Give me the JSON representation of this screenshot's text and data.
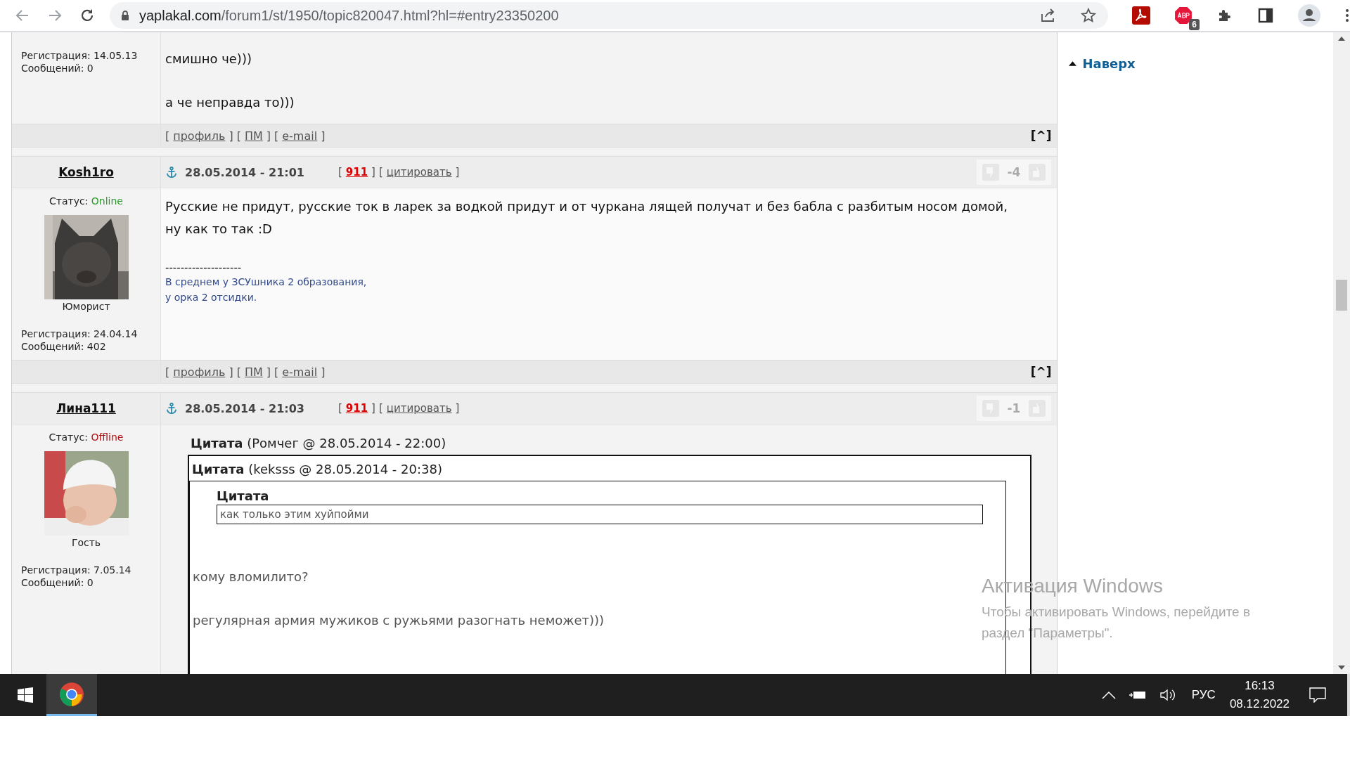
{
  "browser": {
    "url_host": "yaplakal.com",
    "url_path": "/forum1/st/1950/topic820047.html?hl=#entry23350200",
    "extension_badge": "6"
  },
  "posts": [
    {
      "registration": "Регистрация: 14.05.13",
      "messages": "Сообщений: 0",
      "body": [
        {
          "kind": "text",
          "text": "смишно че)))"
        },
        {
          "kind": "text",
          "text": "а че неправда то)))"
        }
      ],
      "footer": [
        {
          "open": "[",
          "text": "профиль",
          "close": "]"
        },
        {
          "open": "[",
          "text": "ПМ",
          "close": "]"
        },
        {
          "open": "[",
          "text": "e-mail",
          "close": "]"
        }
      ],
      "top_link": "[^]"
    },
    {
      "header": {
        "author": "Kosh1ro",
        "date": "28.05.2014 - 21:01",
        "report": {
          "open": "[",
          "text": "911",
          "close": "]"
        },
        "quote": {
          "open": "[",
          "text": "цитировать",
          "close": "]"
        },
        "rating": "-4"
      },
      "status_label": "Статус:",
      "status": "Online",
      "online": true,
      "avatar": {
        "kind": "picture"
      },
      "rank": "Юморист",
      "registration": "Регистрация: 24.04.14",
      "messages": "Сообщений: 402",
      "body": [
        {
          "kind": "text",
          "text": "Русские не придут, русские ток в ларек за водкой придут и от чуркана лящей получат и без бабла с разбитым носом домой, ну как то так :D"
        },
        {
          "kind": "rule",
          "text": "--------------------"
        },
        {
          "kind": "signature",
          "lines": [
            "В среднем у ЗСУшника 2 образования,",
            "у орка 2 отсидки."
          ]
        }
      ],
      "footer": [
        {
          "open": "[",
          "text": "профиль",
          "close": "]"
        },
        {
          "open": "[",
          "text": "ПМ",
          "close": "]"
        },
        {
          "open": "[",
          "text": "e-mail",
          "close": "]"
        }
      ],
      "top_link": "[^]"
    },
    {
      "header": {
        "author": "Лина111",
        "date": "28.05.2014 - 21:03",
        "report": {
          "open": "[",
          "text": "911",
          "close": "]"
        },
        "quote": {
          "open": "[",
          "text": "цитировать",
          "close": "]"
        },
        "rating": "-1"
      },
      "status_label": "Статус:",
      "status": "Offline",
      "online": false,
      "avatar": {
        "kind": "picture"
      },
      "rank": "Гость",
      "registration": "Регистрация: 7.05.14",
      "messages": "Сообщений: 0",
      "body": [
        {
          "kind": "quote",
          "label": "Цитата",
          "source": "(Ромчег @ 28.05.2014 - 22:00)",
          "body": [
            {
              "kind": "quote",
              "label": "Цитата",
              "source": "(keksss @ 28.05.2014 - 20:38)",
              "body": [
                {
                  "kind": "quote",
                  "label": "Цитата",
                  "body": [
                    {
                      "kind": "quoted",
                      "text": "как только этим хуйпойми"
                    }
                  ]
                },
                {
                  "kind": "text",
                  "text": "кому вломилито?"
                },
                {
                  "kind": "text",
                  "text": "регулярная армия мужиков с ружьями разогнать неможет)))"
                }
              ]
            }
          ]
        }
      ]
    }
  ],
  "sidebar": {
    "top_link": "Наверх"
  },
  "activation_notice": {
    "title": "Активация Windows",
    "text": "Чтобы активировать Windows, перейдите в раздел \"Параметры\"."
  },
  "taskbar": {
    "language": "РУС",
    "time": "16:13",
    "date": "08.12.2022"
  }
}
